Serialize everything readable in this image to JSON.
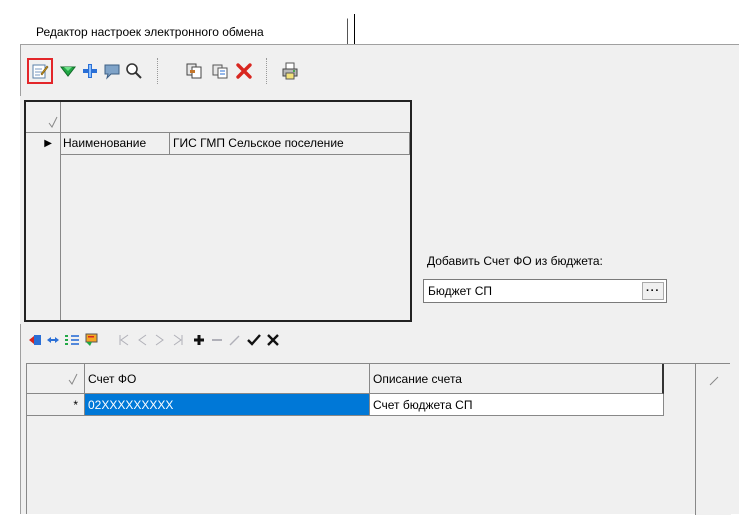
{
  "tab": {
    "label": "Редактор настроек электронного обмена"
  },
  "toolbar": {
    "icons": [
      "edit-icon",
      "filter-icon",
      "add-row-icon",
      "comment-icon",
      "search-icon",
      "copy-icon",
      "paste-icon",
      "delete-icon",
      "print-icon"
    ],
    "highlight_color": "#e3262a"
  },
  "grid_settings": {
    "indicator_row": "▶",
    "row": {
      "name_label": "Наименование",
      "name_value": "ГИС ГМП Сельское поселение"
    }
  },
  "budget": {
    "label": "Добавить Счет ФО из бюджета:",
    "value": "Бюджет СП",
    "button": "···"
  },
  "navbar": {
    "icons": [
      "import-icon",
      "link-icon",
      "list-icon",
      "filter-flag-icon",
      "first-icon",
      "prev-icon",
      "next-icon",
      "last-icon",
      "insert-icon",
      "delete-icon",
      "edit-icon",
      "post-icon",
      "cancel-icon"
    ]
  },
  "grid_accounts": {
    "columns": [
      "Счет ФО",
      "Описание счета"
    ],
    "rows": [
      {
        "indicator": "*",
        "account": "02XXXXXXXXX",
        "description": "Счет бюджета  СП"
      }
    ],
    "selected_color": "#0078d7"
  }
}
